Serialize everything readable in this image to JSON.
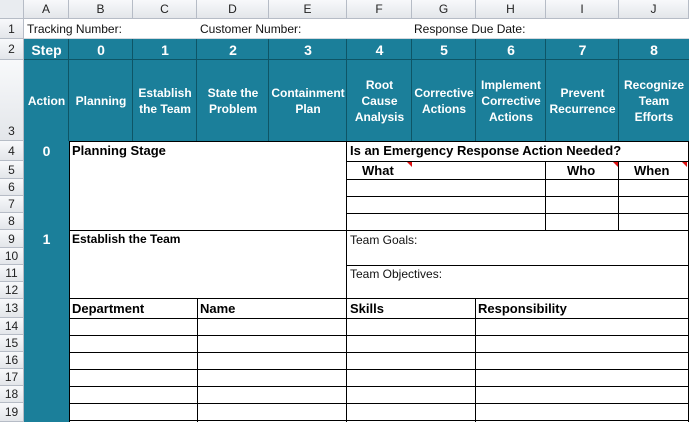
{
  "columns": [
    "A",
    "B",
    "C",
    "D",
    "E",
    "F",
    "G",
    "H",
    "I",
    "J"
  ],
  "rows": [
    "1",
    "2",
    "3",
    "4",
    "5",
    "6",
    "7",
    "8",
    "9",
    "10",
    "11",
    "12",
    "13",
    "14",
    "15",
    "16",
    "17",
    "18",
    "19"
  ],
  "tracking_label": "Tracking Number:",
  "customer_label": "Customer Number:",
  "response_label": "Response Due Date:",
  "step_label": "Step",
  "action_label": "Action",
  "steps": [
    {
      "num": "0",
      "label": "Planning"
    },
    {
      "num": "1",
      "label": "Establish the Team"
    },
    {
      "num": "2",
      "label": "State the Problem"
    },
    {
      "num": "3",
      "label": "Containment Plan"
    },
    {
      "num": "4",
      "label": "Root Cause Analysis"
    },
    {
      "num": "5",
      "label": "Corrective Actions"
    },
    {
      "num": "6",
      "label": "Implement Corrective Actions"
    },
    {
      "num": "7",
      "label": "Prevent Recurrence"
    },
    {
      "num": "8",
      "label": "Recognize Team Efforts"
    }
  ],
  "planning": {
    "num": "0",
    "title": "Planning Stage"
  },
  "emergency": {
    "title": "Is an Emergency Response Action Needed?",
    "what": "What",
    "who": "Who",
    "when": "When"
  },
  "team": {
    "num": "1",
    "title": "Establish the Team",
    "goals": "Team Goals:",
    "objectives": "Team Objectives:"
  },
  "team_table": {
    "department": "Department",
    "name": "Name",
    "skills": "Skills",
    "responsibility": "Responsibility"
  },
  "colors": {
    "teal": "#1b7f9a",
    "note": "#d11111"
  }
}
